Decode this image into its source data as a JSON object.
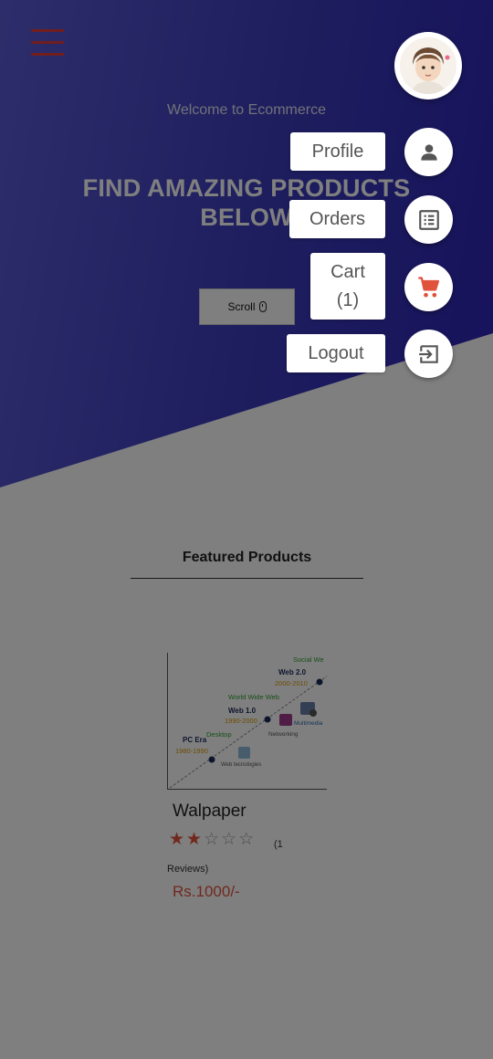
{
  "hero": {
    "welcome": "Welcome to Ecommerce",
    "title": "FIND AMAZING PRODUCTS BELOW",
    "scroll_label": "Scroll"
  },
  "featured": {
    "heading": "Featured Products"
  },
  "product": {
    "name": "Walpaper",
    "rating": 2,
    "rating_max": 5,
    "reviews_part1": "(1",
    "reviews_part2": "Reviews)",
    "price": "Rs.1000/-",
    "image_text": {
      "social": "Social We",
      "web2": "Web 2.0",
      "web2_years": "2000-2010",
      "www": "World Wide Web",
      "web1": "Web 1.0",
      "web1_years": "1990-2000",
      "multimedia": "Multimedia",
      "networking": "Networking",
      "desktop": "Desktop",
      "pc_era": "PC Era",
      "pc_years": "1980-1990",
      "web_tech": "Web tecnologies"
    }
  },
  "speed_dial": {
    "profile": "Profile",
    "orders": "Orders",
    "cart": "Cart (1)",
    "logout": "Logout"
  },
  "colors": {
    "accent": "#e0523c",
    "hero_dark": "#2d23b8",
    "hero_light": "#5b5bd6"
  }
}
